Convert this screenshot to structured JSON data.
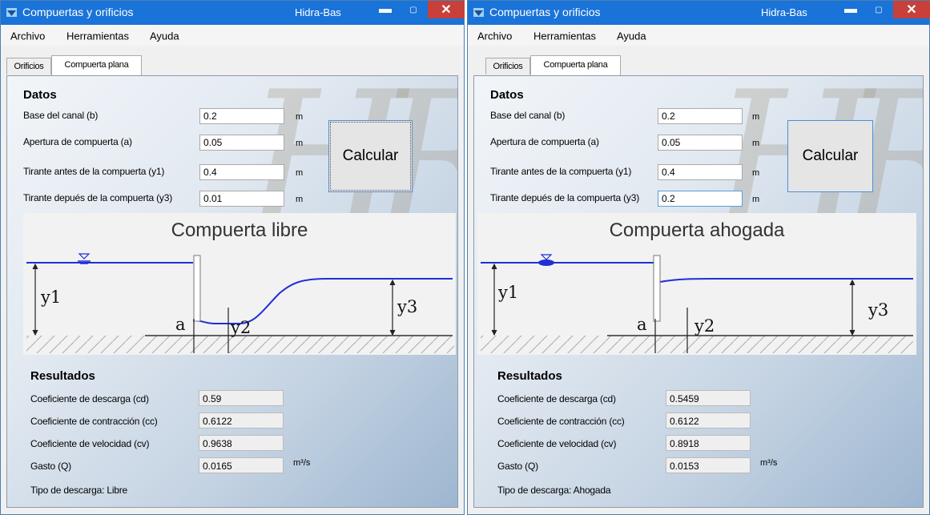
{
  "windows": [
    {
      "title": "Compuertas y orificios",
      "app_name": "Hidra-Bas",
      "menu": [
        "Archivo",
        "Herramientas",
        "Ayuda"
      ],
      "tabs": [
        "Orificios",
        "Compuerta plana"
      ],
      "datos_heading": "Datos",
      "inputs": [
        {
          "label": "Base del canal (b)",
          "value": "0.2",
          "unit": "m"
        },
        {
          "label": "Apertura de compuerta (a)",
          "value": "0.05",
          "unit": "m"
        },
        {
          "label": "Tirante antes de la compuerta (y1)",
          "value": "0.4",
          "unit": "m"
        },
        {
          "label": "Tirante depués de la compuerta (y3)",
          "value": "0.01",
          "unit": "m"
        }
      ],
      "calc_button": "Calcular",
      "diagram": {
        "title": "Compuerta libre",
        "labels": {
          "y1": "y1",
          "a": "a",
          "y2": "y2",
          "y3": "y3"
        }
      },
      "resultados_heading": "Resultados",
      "results": [
        {
          "label": "Coeficiente de descarga (cd)",
          "value": "0.59",
          "unit": ""
        },
        {
          "label": "Coeficiente de contracción (cc)",
          "value": "0.6122",
          "unit": ""
        },
        {
          "label": "Coeficiente de velocidad (cv)",
          "value": "0.9638",
          "unit": ""
        },
        {
          "label": "Gasto (Q)",
          "value": "0.0165",
          "unit": "m³/s"
        }
      ],
      "tipo_descarga": "Tipo de descarga: Libre"
    },
    {
      "title": "Compuertas y orificios",
      "app_name": "Hidra-Bas",
      "menu": [
        "Archivo",
        "Herramientas",
        "Ayuda"
      ],
      "tabs": [
        "Orificios",
        "Compuerta plana"
      ],
      "datos_heading": "Datos",
      "inputs": [
        {
          "label": "Base del canal (b)",
          "value": "0.2",
          "unit": "m"
        },
        {
          "label": "Apertura de compuerta (a)",
          "value": "0.05",
          "unit": "m"
        },
        {
          "label": "Tirante antes de la compuerta (y1)",
          "value": "0.4",
          "unit": "m"
        },
        {
          "label": "Tirante depués de la compuerta (y3)",
          "value": "0.2",
          "unit": "m"
        }
      ],
      "calc_button": "Calcular",
      "diagram": {
        "title": "Compuerta ahogada",
        "labels": {
          "y1": "y1",
          "a": "a",
          "y2": "y2",
          "y3": "y3"
        }
      },
      "resultados_heading": "Resultados",
      "results": [
        {
          "label": "Coeficiente de descarga (cd)",
          "value": "0.5459",
          "unit": ""
        },
        {
          "label": "Coeficiente de contracción (cc)",
          "value": "0.6122",
          "unit": ""
        },
        {
          "label": "Coeficiente de velocidad (cv)",
          "value": "0.8918",
          "unit": ""
        },
        {
          "label": "Gasto (Q)",
          "value": "0.0153",
          "unit": "m³/s"
        }
      ],
      "tipo_descarga": "Tipo de descarga: Ahogada"
    }
  ],
  "colors": {
    "titlebar": "#1a73d8",
    "close": "#c7403a",
    "water": "#1f2fd6",
    "accent": "#4d8fd6"
  },
  "icons": [
    "app-icon",
    "minimize-icon",
    "maximize-icon",
    "close-icon",
    "water-level-icon"
  ],
  "watermark": "HR"
}
